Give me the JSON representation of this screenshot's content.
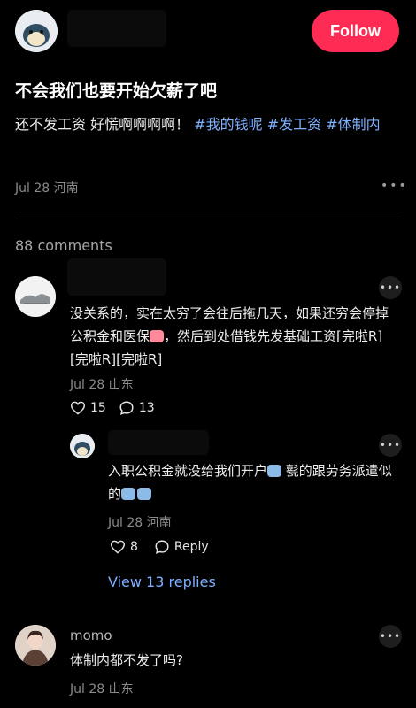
{
  "header": {
    "follow_label": "Follow"
  },
  "post": {
    "title": "不会我们也要开始欠薪了吧",
    "text_plain": "还不发工资  好慌啊啊啊啊！",
    "tags": [
      "#我的钱呢",
      "#发工资",
      "#体制内"
    ],
    "date": "Jul 28",
    "location": "河南"
  },
  "comments": {
    "count_label": "88 comments",
    "items": [
      {
        "text_part1": "没关系的，实在太穷了会往后拖几天，如果还穷会停掉公积金和医保",
        "text_part2": "，然后到处借钱先发基础工资[完啦R][完啦R][完啦R]",
        "date": "Jul 28",
        "location": "山东",
        "likes": "15",
        "replies": "13",
        "reply": {
          "text_part1": "入职公积金就没给我们开户",
          "text_part2": " 甏的跟劳务派遣似的",
          "date": "Jul 28",
          "location": "河南",
          "likes": "8",
          "reply_label": "Reply"
        },
        "view_replies_label": "View 13 replies"
      },
      {
        "username": "momo",
        "text": "体制内都不发了吗?",
        "date": "Jul 28",
        "location": "山东"
      }
    ]
  },
  "icons": {
    "more": "more-dots-icon",
    "heart": "heart-icon",
    "comment": "comment-bubble-icon",
    "reply": "reply-bubble-icon"
  },
  "colors": {
    "accent": "#fe2c55",
    "hashtag": "#7fb0ff",
    "background": "#000000"
  }
}
